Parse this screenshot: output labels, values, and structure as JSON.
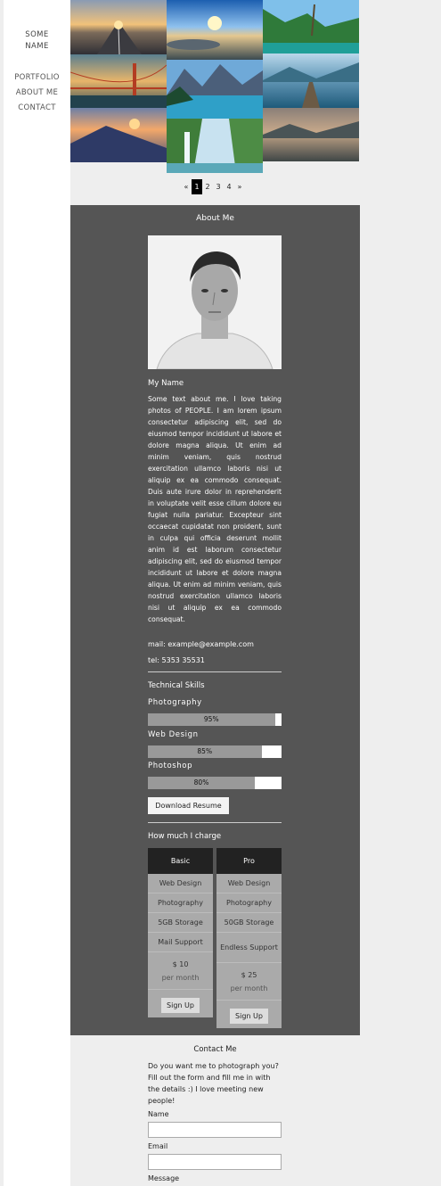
{
  "sidebar": {
    "brand_line1": "SOME",
    "brand_line2": "NAME",
    "nav": [
      "PORTFOLIO",
      "ABOUT ME",
      "CONTACT"
    ]
  },
  "gallery": {
    "tiles": [
      "road-sunset",
      "sunny-beach",
      "tropical-island",
      "golden-gate-bridge",
      "mountain-lake",
      "pier-lake",
      "mountain-sunrise",
      "waterfall",
      "misty-lake"
    ]
  },
  "pagination": {
    "prev": "«",
    "pages": [
      "1",
      "2",
      "3",
      "4"
    ],
    "next": "»",
    "active": "1"
  },
  "about": {
    "heading": "About Me",
    "name": "My Name",
    "bio": "Some text about me. I love taking photos of PEOPLE. I am lorem ipsum consectetur adipiscing elit, sed do eiusmod tempor incididunt ut labore et dolore magna aliqua. Ut enim ad minim veniam, quis nostrud exercitation ullamco laboris nisi ut aliquip ex ea commodo consequat. Duis aute irure dolor in reprehenderit in voluptate velit esse cillum dolore eu fugiat nulla pariatur. Excepteur sint occaecat cupidatat non proident, sunt in culpa qui officia deserunt mollit anim id est laborum consectetur adipiscing elit, sed do eiusmod tempor incididunt ut labore et dolore magna aliqua. Ut enim ad minim veniam, quis nostrud exercitation ullamco laboris nisi ut aliquip ex ea commodo consequat.",
    "mail": "mail: example@example.com",
    "tel": "tel: 5353 35531",
    "skills_heading": "Technical Skills",
    "skills": [
      {
        "name": "Photography",
        "percent": 95,
        "label": "95%"
      },
      {
        "name": "Web Design",
        "percent": 85,
        "label": "85%"
      },
      {
        "name": "Photoshop",
        "percent": 80,
        "label": "80%"
      }
    ],
    "download_label": "Download Resume",
    "charge_heading": "How much I charge",
    "plans": [
      {
        "name": "Basic",
        "features": [
          "Web Design",
          "Photography",
          "5GB Storage",
          "Mail Support"
        ],
        "price": "$ 10",
        "per": "per month",
        "signup": "Sign Up"
      },
      {
        "name": "Pro",
        "features": [
          "Web Design",
          "Photography",
          "50GB Storage",
          "Endless Support"
        ],
        "price": "$ 25",
        "per": "per month",
        "signup": "Sign Up"
      }
    ]
  },
  "contact": {
    "heading": "Contact Me",
    "text": "Do you want me to photograph you? Fill out the form and fill me in with the details :) I love meeting new people!",
    "name_label": "Name",
    "email_label": "Email",
    "message_label": "Message"
  },
  "colors": {
    "page_bg": "#eeeeee",
    "panel_bg": "#555555",
    "plan_header": "#222222",
    "plan_body": "#aaaaaa",
    "bar_fill": "#999999"
  }
}
